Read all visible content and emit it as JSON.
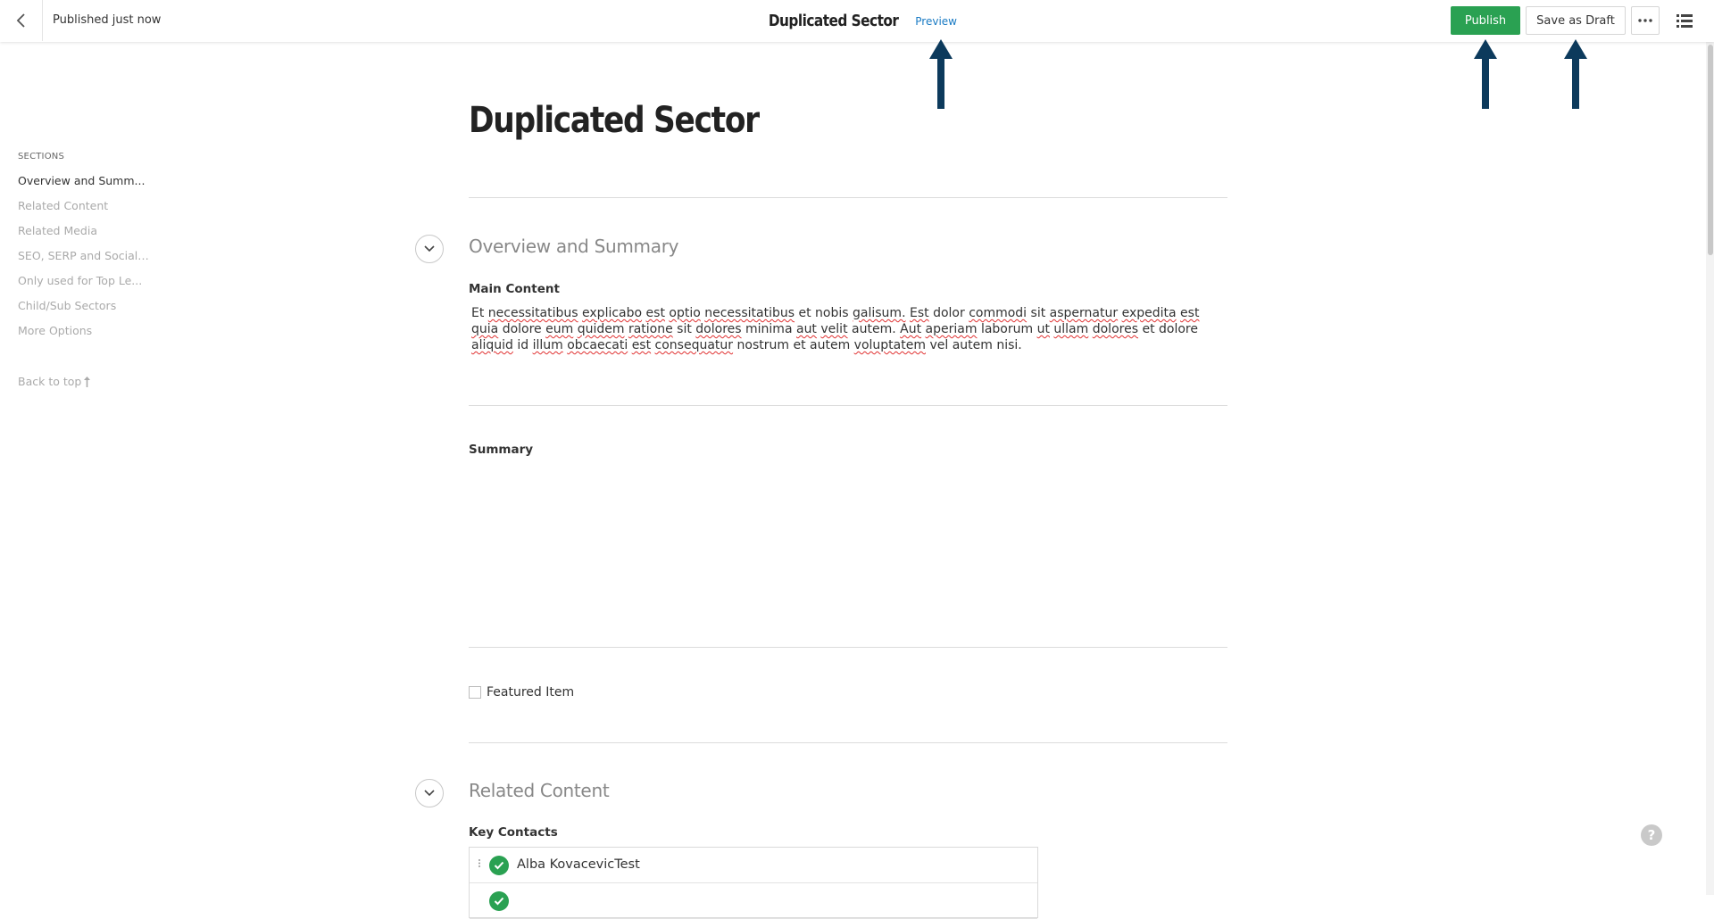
{
  "header": {
    "status": "Published just now",
    "title": "Duplicated Sector",
    "preview_label": "Preview",
    "publish_label": "Publish",
    "save_draft_label": "Save as Draft"
  },
  "sidebar": {
    "sections_label": "SECTIONS",
    "items": [
      {
        "label": "Overview and Summ..."
      },
      {
        "label": "Related Content"
      },
      {
        "label": "Related Media"
      },
      {
        "label": "SEO, SERP and Social ..."
      },
      {
        "label": "Only used for Top Le..."
      },
      {
        "label": "Child/Sub Sectors"
      },
      {
        "label": "More Options"
      }
    ],
    "back_to_top": "Back to top"
  },
  "main": {
    "page_title": "Duplicated Sector",
    "overview_section": {
      "title": "Overview and Summary",
      "main_content_label": "Main Content",
      "main_content_text": "Et necessitatibus explicabo est optio necessitatibus et nobis galisum. Est dolor commodi sit aspernatur expedita est quia dolore eum quidem ratione sit dolores minima aut velit autem. Aut aperiam laborum ut ullam dolores et dolore aliquid id illum obcaecati est consequatur nostrum et autem voluptatem vel autem nisi.",
      "summary_label": "Summary",
      "featured_label": "Featured Item"
    },
    "related_section": {
      "title": "Related Content",
      "key_contacts_label": "Key Contacts",
      "contacts": [
        {
          "name": "Alba KovacevicTest"
        }
      ]
    }
  },
  "colors": {
    "publish_green": "#2aa152",
    "arrow_navy": "#0c3a5c",
    "link_blue": "#1a7bc4"
  },
  "icons": [
    "back-arrow-icon",
    "ellipsis-icon",
    "list-view-icon",
    "chevron-down-icon",
    "check-icon",
    "drag-handle-icon",
    "help-icon",
    "arrow-up-icon"
  ]
}
